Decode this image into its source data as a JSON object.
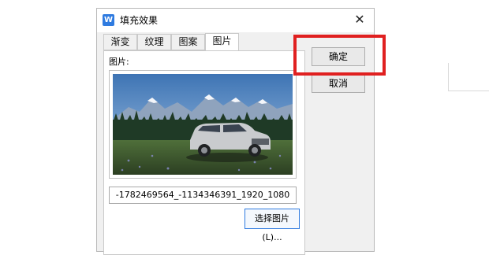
{
  "dialog": {
    "title": "填充效果",
    "app_icon_letter": "W",
    "close_glyph": "✕"
  },
  "tabs": [
    {
      "label": "渐变",
      "active": false
    },
    {
      "label": "纹理",
      "active": false
    },
    {
      "label": "图案",
      "active": false
    },
    {
      "label": "图片",
      "active": true
    }
  ],
  "picture_panel": {
    "label": "图片:",
    "filename": "-1782469564_-1134346391_1920_1080",
    "select_button": "选择图片(L)..."
  },
  "buttons": {
    "ok": "确定",
    "cancel": "取消"
  },
  "colors": {
    "highlight": "#e02020",
    "accent": "#2f7be0"
  }
}
